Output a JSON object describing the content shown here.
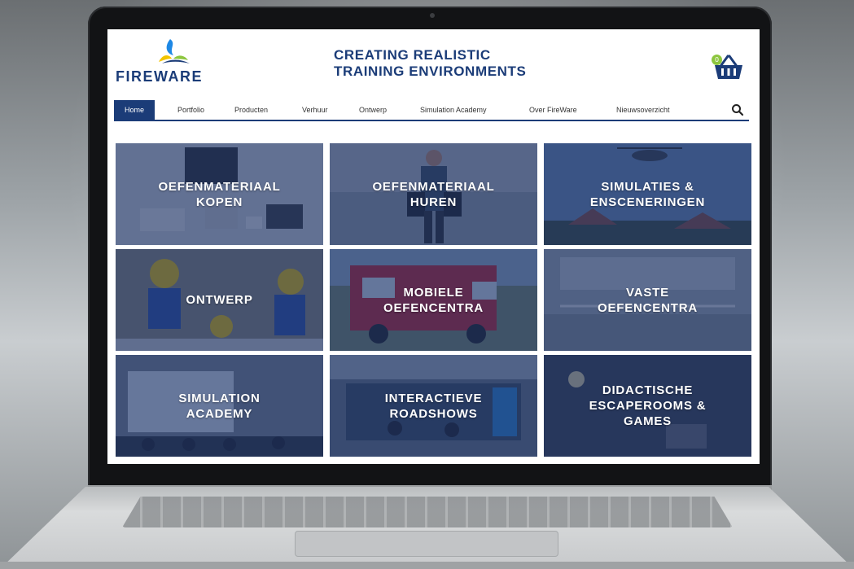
{
  "brand": {
    "name": "FIREWARE",
    "tagline_line1": "CREATING REALISTIC",
    "tagline_line2": "TRAINING ENVIRONMENTS",
    "colors": {
      "navy": "#1b3c78",
      "accent_green": "#8dc63f",
      "accent_yellow": "#f2c500",
      "accent_blue": "#1e88e5"
    }
  },
  "cart": {
    "icon": "basket-icon",
    "badge": "0"
  },
  "nav": {
    "items": [
      {
        "label": "Home",
        "active": true
      },
      {
        "label": "Portfolio"
      },
      {
        "label": "Producten"
      },
      {
        "label": "Verhuur"
      },
      {
        "label": "Ontwerp"
      },
      {
        "label": "Simulation Academy"
      },
      {
        "label": "Over FireWare"
      },
      {
        "label": "Nieuwsoverzicht"
      }
    ],
    "search_icon": "search-icon"
  },
  "tiles": [
    {
      "label": "OEFENMATERIAAL\nKOPEN",
      "scene": "training equipment cases"
    },
    {
      "label": "OEFENMATERIAAL\nHUREN",
      "scene": "person carrying equipment"
    },
    {
      "label": "SIMULATIES &\nENSCENERINGEN",
      "scene": "helicopter over houses"
    },
    {
      "label": "ONTWERP",
      "scene": "toy figures"
    },
    {
      "label": "MOBIELE\nOEFENCENTRA",
      "scene": "red fire truck"
    },
    {
      "label": "VASTE\nOEFENCENTRA",
      "scene": "indoor training facility"
    },
    {
      "label": "SIMULATION\nACADEMY",
      "scene": "conference room"
    },
    {
      "label": "INTERACTIEVE\nROADSHOWS",
      "scene": "exhibition stand"
    },
    {
      "label": "DIDACTISCHE\nESCAPEROOMS &\nGAMES",
      "scene": "escape room"
    }
  ]
}
